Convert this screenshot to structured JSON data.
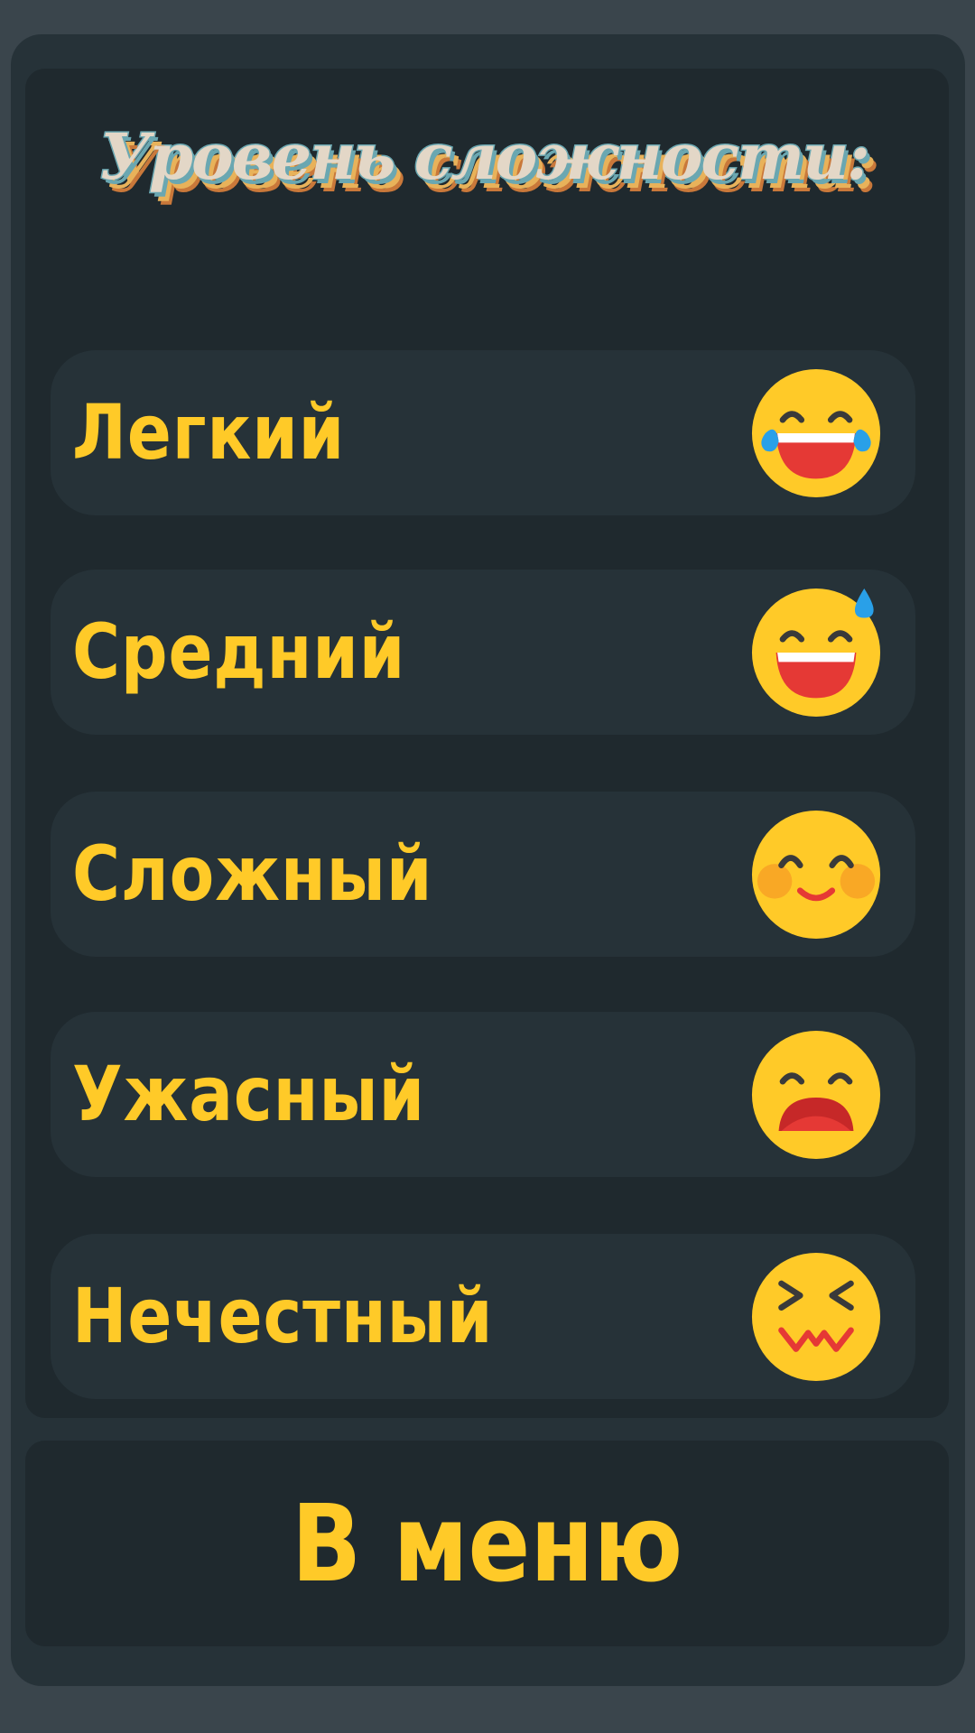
{
  "title": "Уровень сложности:",
  "levels": [
    {
      "label": "Легкий",
      "icon": "face-with-tears-of-joy-icon"
    },
    {
      "label": "Средний",
      "icon": "grinning-face-with-sweat-icon"
    },
    {
      "label": "Сложный",
      "icon": "smiling-face-with-blushing-cheeks-icon"
    },
    {
      "label": "Ужасный",
      "icon": "anguished-open-mouth-face-icon"
    },
    {
      "label": "Нечестный",
      "icon": "confounded-face-icon"
    }
  ],
  "menu_button": {
    "label": "В меню"
  },
  "colors": {
    "background": "#3a454c",
    "panel": "#263238",
    "panel_dark": "#1f292e",
    "text_accent": "#ffca28",
    "emoji_yellow": "#ffca28",
    "title_fill": "#e3d7c7",
    "title_outline": "#6aa7b1",
    "title_shadow": "#e8b25a"
  }
}
